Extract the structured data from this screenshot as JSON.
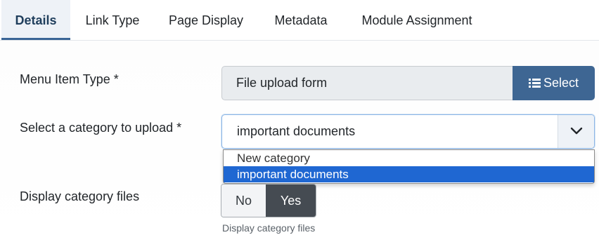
{
  "tabs": [
    "Details",
    "Link Type",
    "Page Display",
    "Metadata",
    "Module Assignment"
  ],
  "menu_item_type": {
    "label": "Menu Item Type *",
    "value": "File upload form",
    "button_label": "Select",
    "button_icon": "list-icon"
  },
  "category": {
    "label": "Select a category to upload *",
    "value": "important documents",
    "options": [
      "New category",
      "important documents"
    ],
    "selected_index": 1
  },
  "display_files": {
    "label": "Display category files",
    "no_label": "No",
    "yes_label": "Yes",
    "selected": "Yes",
    "help": "Display category files"
  },
  "colors": {
    "accent": "#3e6693",
    "selection": "#1f67d2",
    "toggle_active": "#454b52"
  }
}
